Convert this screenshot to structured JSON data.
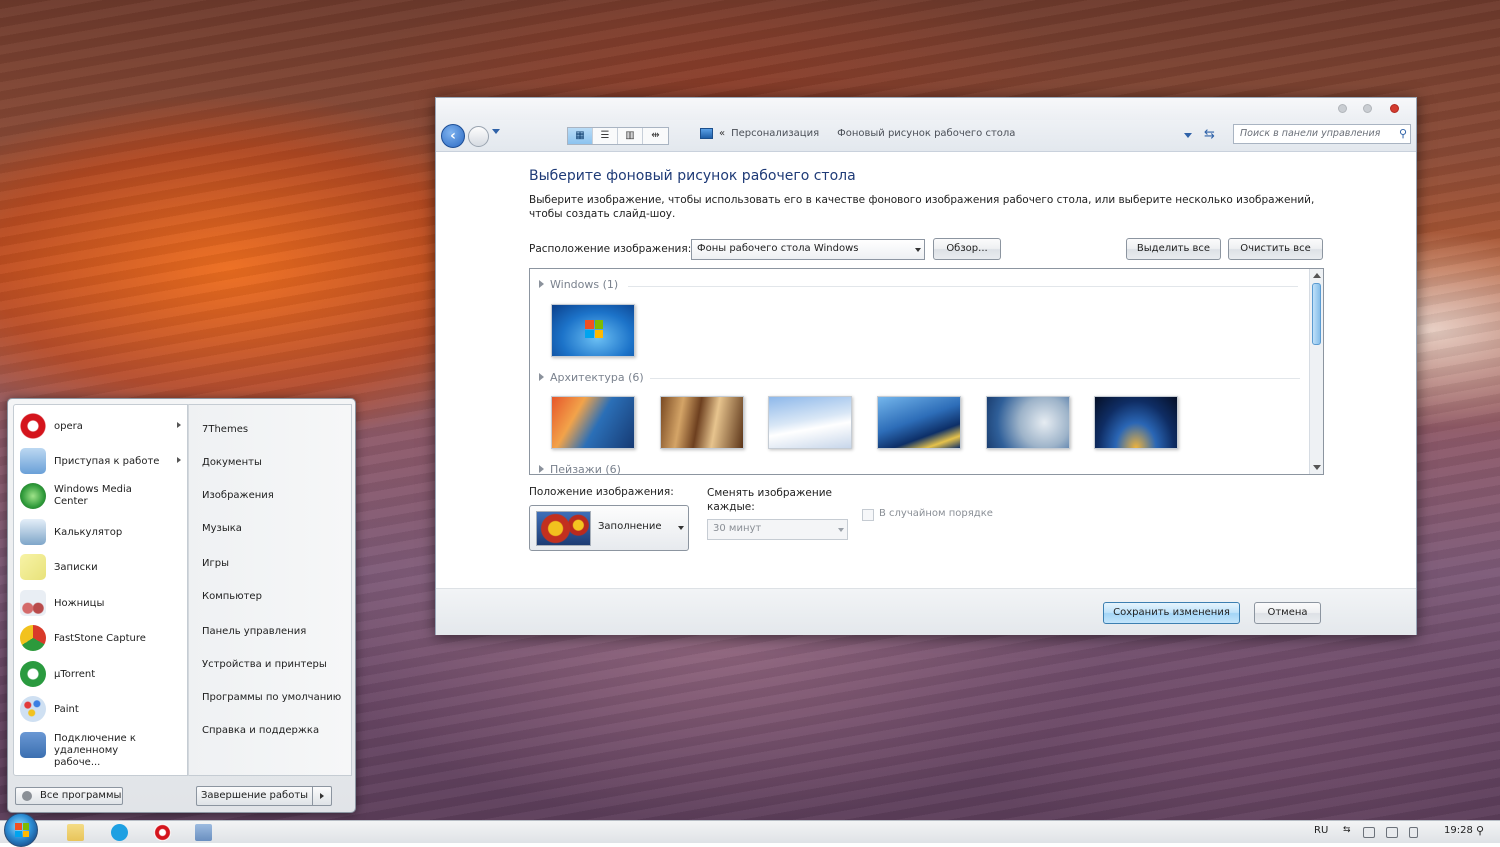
{
  "window": {
    "breadcrumb": {
      "prefix": "«",
      "items": [
        "Персонализация",
        "Фоновый рисунок рабочего стола"
      ]
    },
    "search_placeholder": "Поиск в панели управления",
    "view_buttons": [
      "▦",
      "☰",
      "▥",
      "⇹"
    ],
    "heading": "Выберите фоновый рисунок рабочего стола",
    "description": "Выберите изображение, чтобы использовать его в качестве фонового изображения рабочего стола, или выберите несколько изображений, чтобы создать слайд-шоу.",
    "location_label": "Расположение изображения:",
    "location_value": "Фоны рабочего стола Windows",
    "browse_label": "Обзор...",
    "select_all_label": "Выделить все",
    "clear_all_label": "Очистить все",
    "groups": [
      {
        "label": "Windows (1)",
        "count": 1
      },
      {
        "label": "Архитектура (6)",
        "count": 6
      },
      {
        "label": "Пейзажи (6)",
        "count": 6
      }
    ],
    "position_label": "Положение изображения:",
    "position_value": "Заполнение",
    "change_label": "Сменять изображение каждые:",
    "change_value": "30 минут",
    "shuffle_label": "В случайном порядке",
    "save_label": "Сохранить изменения",
    "cancel_label": "Отмена"
  },
  "start_menu": {
    "apps": [
      {
        "label": "opera",
        "icon": "opera-icon",
        "color": "#d4141c",
        "submenu": true
      },
      {
        "label": "Приступая к работе",
        "icon": "getting-started-icon",
        "color": "#6aa0d8",
        "submenu": true
      },
      {
        "label": "Windows Media Center",
        "icon": "media-center-icon",
        "color": "#2f9a3a",
        "submenu": false
      },
      {
        "label": "Калькулятор",
        "icon": "calculator-icon",
        "color": "#7fa6c9",
        "submenu": false
      },
      {
        "label": "Записки",
        "icon": "sticky-notes-icon",
        "color": "#e8e27a",
        "submenu": false
      },
      {
        "label": "Ножницы",
        "icon": "snipping-tool-icon",
        "color": "#b94b4b",
        "submenu": false
      },
      {
        "label": "FastStone Capture",
        "icon": "faststone-icon",
        "color": "#d93a2a",
        "submenu": false
      },
      {
        "label": "µTorrent",
        "icon": "utorrent-icon",
        "color": "#2a9a3f",
        "submenu": false
      },
      {
        "label": "Paint",
        "icon": "paint-icon",
        "color": "#7aa8d6",
        "submenu": false
      },
      {
        "label": "Подключение к удаленному рабоче...",
        "icon": "remote-desktop-icon",
        "color": "#3b6fb0",
        "submenu": false
      }
    ],
    "places": [
      "7Themes",
      "Документы",
      "Изображения",
      "Музыка",
      "Игры",
      "Компьютер",
      "Панель управления",
      "Устройства и принтеры",
      "Программы по умолчанию",
      "Справка и поддержка"
    ],
    "all_programs_label": "Все программы",
    "shutdown_label": "Завершение работы"
  },
  "taskbar": {
    "lang": "RU",
    "time": "19:28",
    "pinned": [
      {
        "icon": "explorer-icon",
        "color": "#e8c45a"
      },
      {
        "icon": "skype-icon",
        "color": "#1ea0e2"
      },
      {
        "icon": "opera-icon",
        "color": "#d4141c"
      },
      {
        "icon": "control-panel-icon",
        "color": "#6a8fc0"
      }
    ]
  },
  "colors": {
    "accent": "#1f3b77",
    "primary_button": "#bfe3fa",
    "close": "#d33b2f"
  }
}
